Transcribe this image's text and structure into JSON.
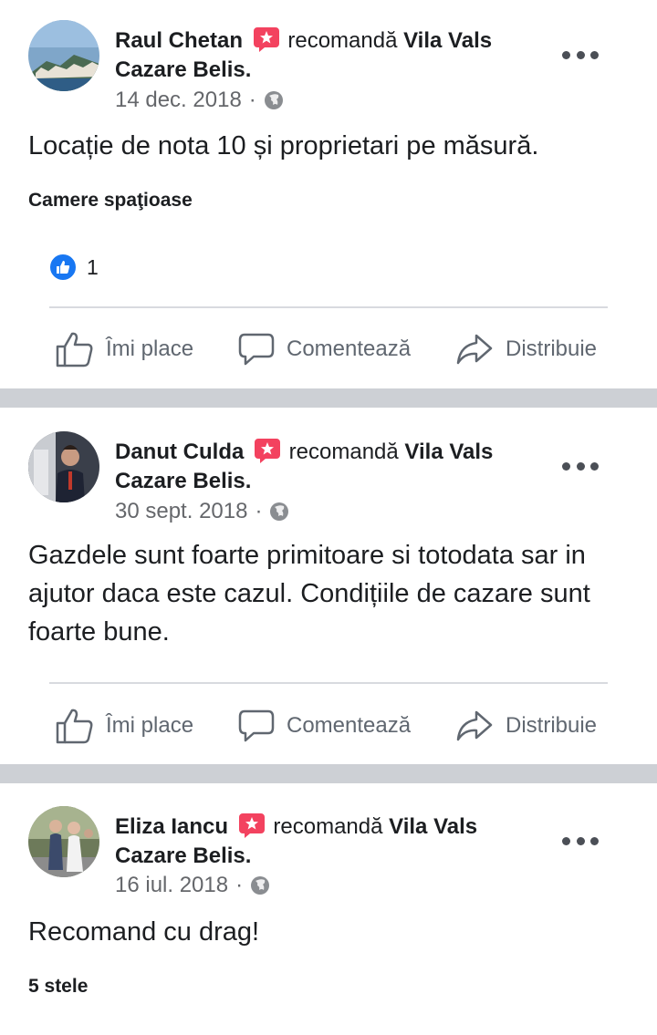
{
  "posts": [
    {
      "author": "Raul Chetan",
      "verb": "recomandă",
      "page": "Vila Vals",
      "page_cont": "Cazare Belis.",
      "date": "14 dec. 2018",
      "separator": "·",
      "text": "Locație de nota 10 și proprietari pe măsură.",
      "tag": "Camere spaţioase",
      "likes": "1"
    },
    {
      "author": "Danut Culda",
      "verb": "recomandă",
      "page": "Vila Vals",
      "page_cont": "Cazare Belis.",
      "date": "30 sept. 2018",
      "separator": "·",
      "text": "Gazdele sunt foarte primitoare si totodata sar in ajutor daca este cazul. Condițiile de cazare sunt foarte bune."
    },
    {
      "author": "Eliza Iancu",
      "verb": "recomandă",
      "page": "Vila Vals",
      "page_cont": "Cazare Belis.",
      "date": "16 iul. 2018",
      "separator": "·",
      "text": "Recomand cu drag!",
      "tag": "5 stele"
    }
  ],
  "actions": {
    "like_label": "Îmi place",
    "comment_label": "Comentează",
    "share_label": "Distribuie"
  },
  "icons": {
    "recommend": "recommend-badge-icon",
    "privacy": "globe-icon",
    "more": "more-options-icon",
    "like": "thumbs-up-icon",
    "comment": "comment-bubble-icon",
    "share": "share-arrow-icon"
  },
  "colors": {
    "recommend_badge": "#f3425f",
    "like_blue": "#1877f2",
    "separator": "#cdd0d5",
    "secondary_text": "#65676b"
  }
}
